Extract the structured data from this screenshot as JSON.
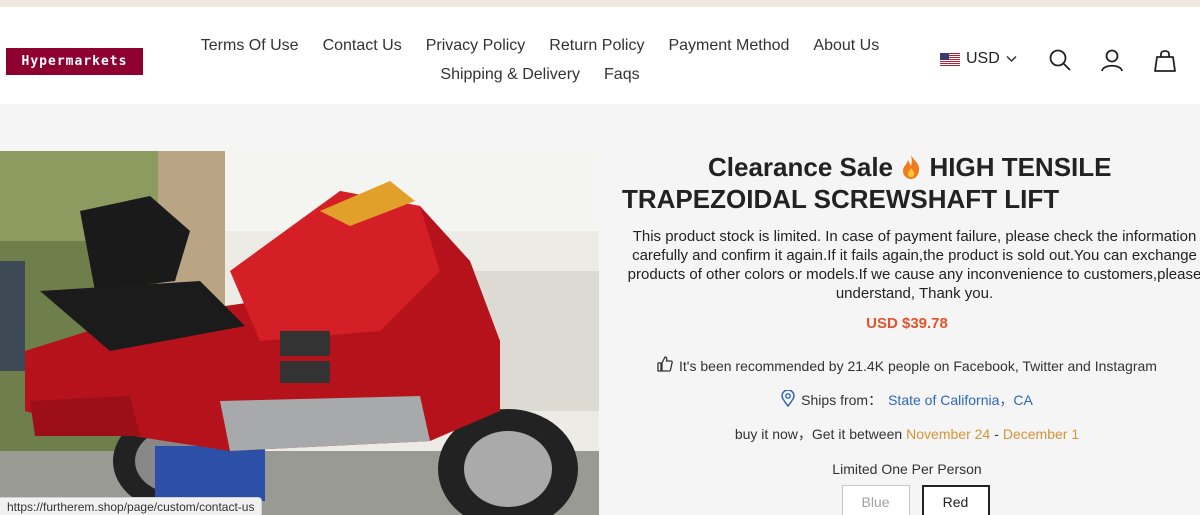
{
  "header": {
    "logo": "Hypermarkets",
    "nav_row1": [
      "Terms Of Use",
      "Contact Us",
      "Privacy Policy",
      "Return Policy",
      "Payment Method",
      "About Us"
    ],
    "nav_row2": [
      "Shipping & Delivery",
      "Faqs"
    ],
    "currency": "USD",
    "icons": [
      "search-icon",
      "user-icon",
      "bag-icon",
      "chevron-down-icon",
      "us-flag-icon"
    ]
  },
  "product": {
    "title_line1_a": "Clearance Sale",
    "title_line1_b": "HIGH TENSILE",
    "title_line2": "TRAPEZOIDAL SCREWSHAFT LIFT",
    "description": "This product stock is limited. In case of payment failure, please check the information carefully and confirm it again.If it fails again,the product is sold out.You can exchange products of other colors or models.If we cause any inconvenience to customers,please understand, Thank you.",
    "price": "USD $39.78",
    "recommendation": "It's been recommended by 21.4K people on Facebook, Twitter and Instagram",
    "ships_from_label": "Ships from：",
    "ships_from_location": "State of California，CA",
    "delivery_prefix": "buy it now，Get it between",
    "delivery_start": "November 24",
    "delivery_sep": " - ",
    "delivery_end": "December 1",
    "limit_note": "Limited One Per Person",
    "options": [
      "Blue",
      "Red"
    ],
    "selected_option": "Red"
  },
  "statusbar": {
    "url": "https://furtherem.shop/page/custom/contact-us"
  },
  "colors": {
    "brand": "#8e0030",
    "price": "#e0542e",
    "link_blue": "#2f67b8",
    "date_orange": "#d49334"
  }
}
